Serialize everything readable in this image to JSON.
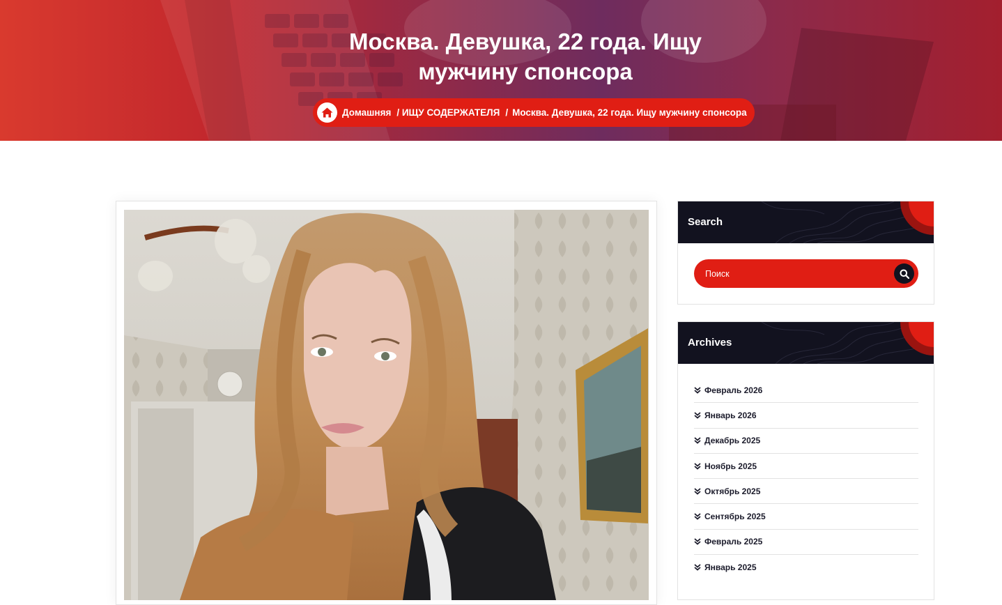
{
  "hero": {
    "title_line1": "Москва. Девушка, 22 года. Ищу",
    "title_line2": "мужчину спонсора"
  },
  "breadcrumb": {
    "home": "Домашняя",
    "category": "/ ИЩУ СОДЕРЖАТЕЛЯ",
    "separator": "/",
    "current": "Москва. Девушка, 22 года. Ищу мужчину спонсора"
  },
  "sidebar": {
    "search": {
      "title": "Search",
      "placeholder": "Поиск"
    },
    "archives": {
      "title": "Archives",
      "items": [
        "Февраль 2026",
        "Январь 2026",
        "Декабрь 2025",
        "Ноябрь 2025",
        "Октябрь 2025",
        "Сентябрь 2025",
        "Февраль 2025",
        "Январь 2025"
      ]
    }
  },
  "icons": {
    "home": "home-icon",
    "search": "search-icon",
    "archive_bullet": "double-chevron-down-icon"
  },
  "colors": {
    "accent": "#e01e14",
    "dark": "#12121f",
    "text_dark": "#1b1b2b"
  }
}
